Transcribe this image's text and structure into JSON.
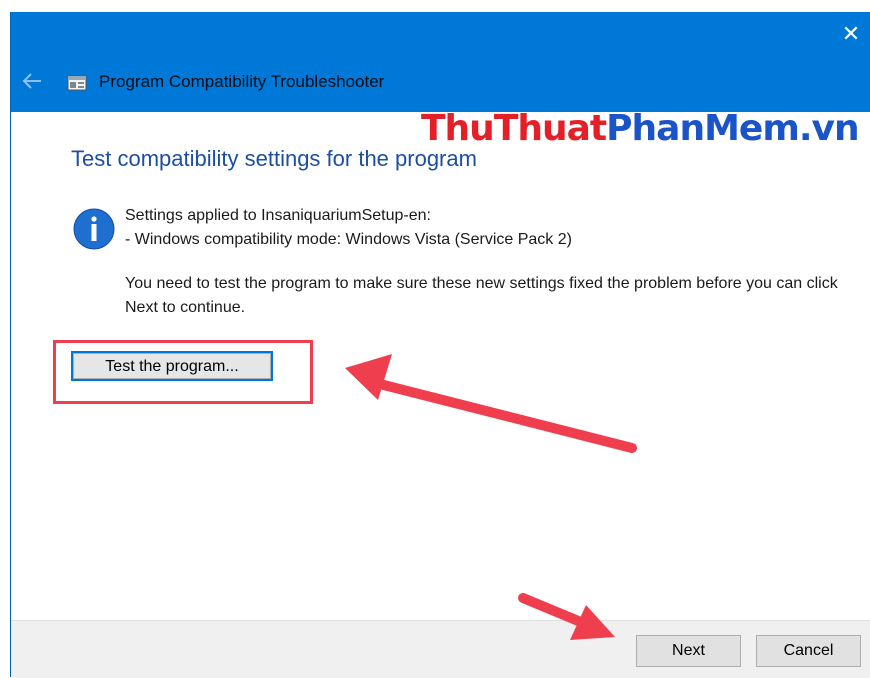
{
  "window": {
    "title": "Program Compatibility Troubleshooter",
    "close_glyph": "✕"
  },
  "watermark": {
    "part1": "Thu",
    "part2": "Thuat",
    "part3": "PhanMem",
    "part4": ".vn"
  },
  "main": {
    "heading": "Test compatibility settings for the program",
    "settings_line1": "Settings applied to InsaniquariumSetup-en:",
    "settings_line2": "- Windows compatibility mode: Windows Vista (Service Pack 2)",
    "instruction": "You need to test the program to make sure these new settings fixed the problem before you can click Next to continue.",
    "test_button_label": "Test the program..."
  },
  "footer": {
    "next_label": "Next",
    "cancel_label": "Cancel"
  },
  "colors": {
    "titlebar": "#0078d7",
    "heading": "#1c4fa0",
    "annotation_red": "#ef3f4f"
  },
  "icons": {
    "back": "back-arrow-icon",
    "app": "troubleshooter-app-icon",
    "info": "info-icon",
    "close": "close-icon"
  }
}
